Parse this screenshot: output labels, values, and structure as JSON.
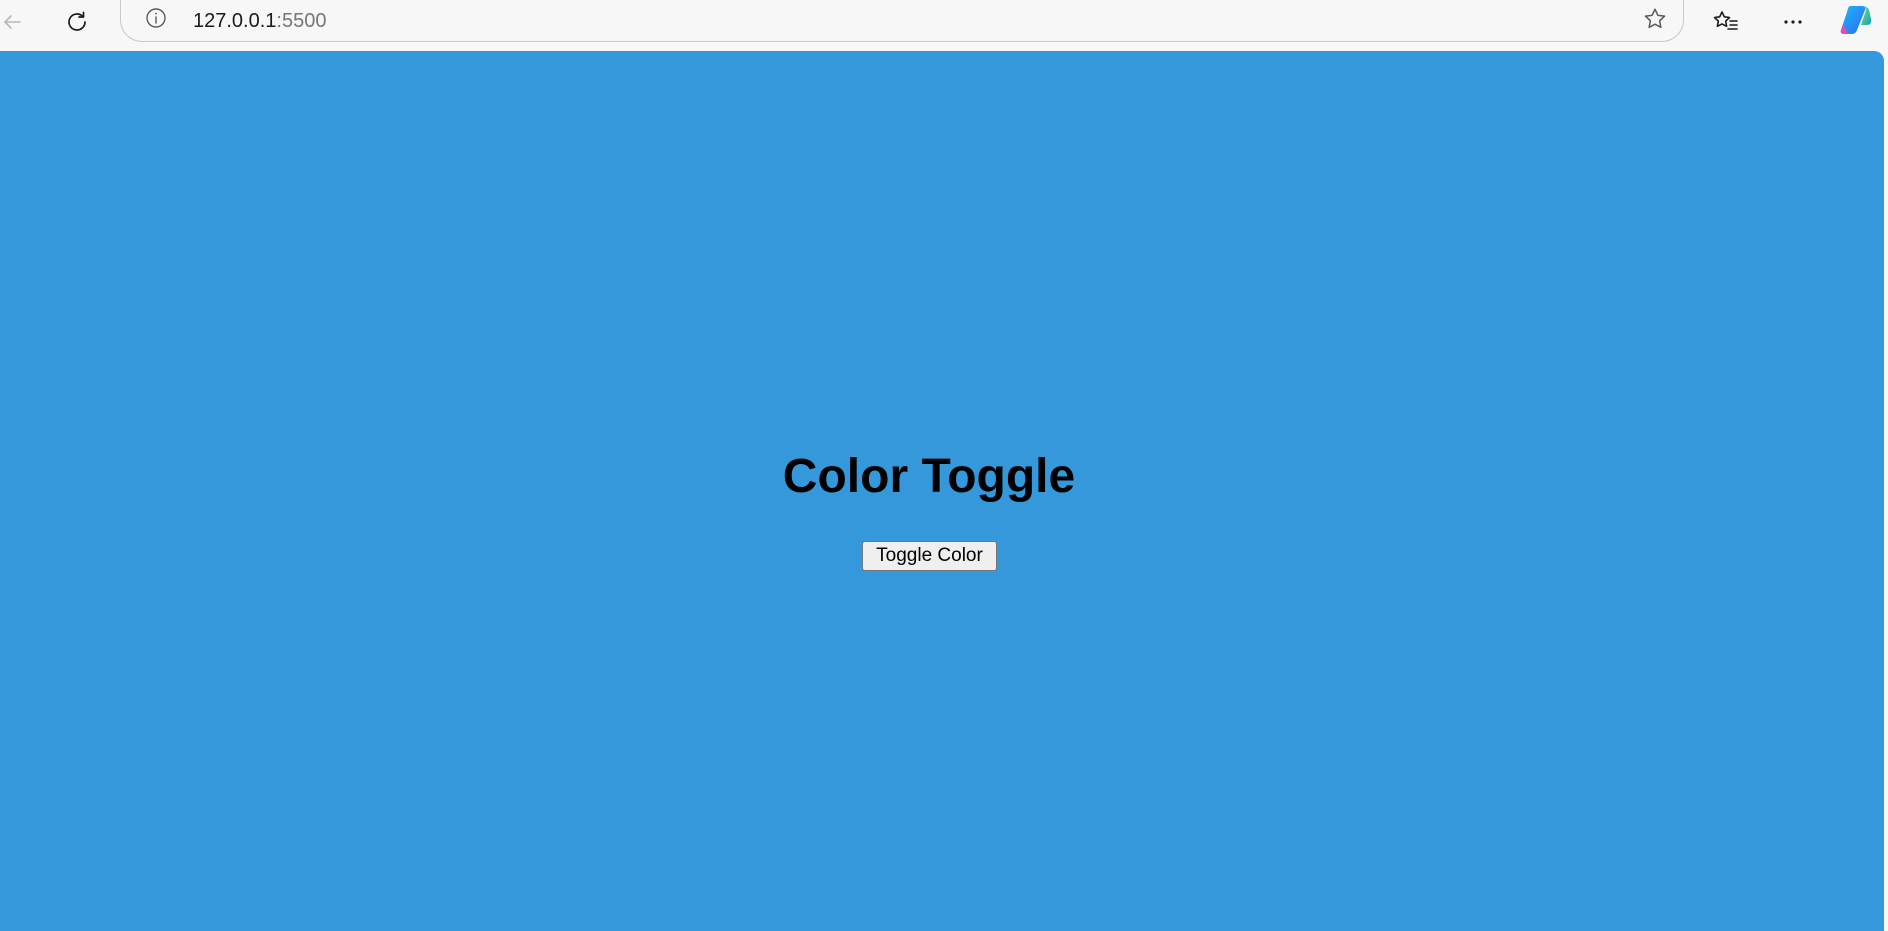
{
  "browser": {
    "url_host": "127.0.0.1",
    "url_port": ":5500",
    "icons": {
      "back": "back-arrow-icon",
      "reload": "reload-icon",
      "site_info": "info-icon",
      "favorite": "star-icon",
      "favorites": "favorites-icon",
      "more": "more-icon",
      "copilot": "copilot-icon"
    }
  },
  "page": {
    "heading": "Color Toggle",
    "button_label": "Toggle Color",
    "background_color": "#3498db"
  }
}
